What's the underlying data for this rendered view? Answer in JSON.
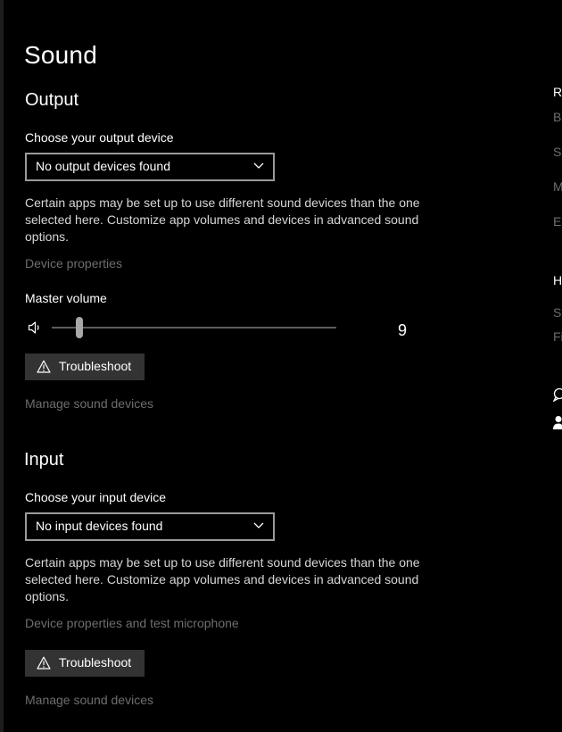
{
  "page": {
    "title": "Sound"
  },
  "output": {
    "section_title": "Output",
    "device_label": "Choose your output device",
    "device_value": "No output devices found",
    "description": "Certain apps may be set up to use different sound devices than the one selected here. Customize app volumes and devices in advanced sound options.",
    "device_properties_link": "Device properties",
    "master_volume_label": "Master volume",
    "master_volume_value": "9",
    "troubleshoot_label": "Troubleshoot",
    "manage_devices_link": "Manage sound devices"
  },
  "input": {
    "section_title": "Input",
    "device_label": "Choose your input device",
    "device_value": "No input devices found",
    "description": "Certain apps may be set up to use different sound devices than the one selected here. Customize app volumes and devices in advanced sound options.",
    "device_properties_link": "Device properties and test microphone",
    "troubleshoot_label": "Troubleshoot",
    "manage_devices_link": "Manage sound devices"
  },
  "related_settings_partial": {
    "heading": "Re",
    "items": [
      "Bl",
      "Sc",
      "M",
      "Ea"
    ]
  },
  "help_partial": {
    "heading": "H",
    "items": [
      "Se",
      "Fi"
    ]
  },
  "icons": {
    "speaker": "speaker-icon",
    "warning": "warning-triangle-icon",
    "chevron": "chevron-down-icon",
    "feedback": "feedback-icon",
    "person": "person-icon"
  },
  "colors": {
    "background": "#000000",
    "text": "#ffffff",
    "disabled_text": "#6e6e6e",
    "button_bg": "#333333",
    "select_border": "#9a9a9a",
    "slider_thumb": "#a8a8a8",
    "slider_track": "#5c5c5c"
  }
}
